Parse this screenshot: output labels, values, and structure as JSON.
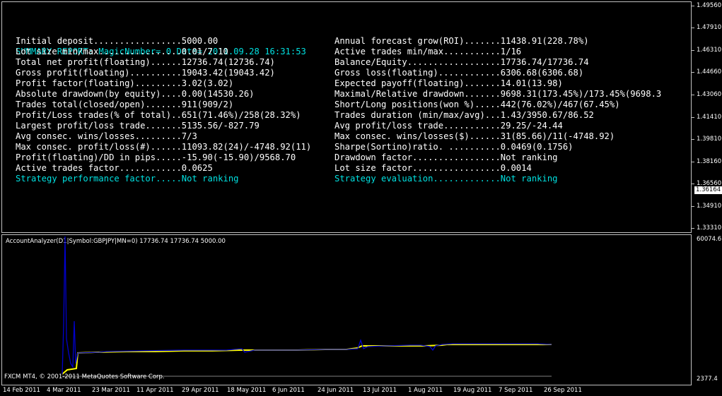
{
  "report": {
    "header": "SUMMARY REPORT: MagicNumber= 0 Date= 2011.09.28 16:31:53",
    "left": [
      "Initial deposit.................5000.00",
      "Lot size min/max................0.01/7.10",
      "Total net profit(floating)......12736.74(12736.74)",
      "Gross profit(floating)..........19043.42(19043.42)",
      "Profit factor(floating).........3.02(3.02)",
      "Absolute drawdown(by equity)....0.00(14530.26)",
      "Trades total(closed/open).......911(909/2)",
      "Profit/Loss trades(% of total)..651(71.46%)/258(28.32%)",
      "Largest profit/loss trade.......5135.56/-827.79",
      "Avg consec. wins/losses.........7/3",
      "Max consec. profit/loss(#)......11093.82(24)/-4748.92(11)",
      "Profit(floating)/DD in pips.....-15.90(-15.90)/9568.70",
      "Active trades factor............0.0625"
    ],
    "left_last": "Strategy performance factor.....Not ranking",
    "right": [
      "Annual forecast grow(ROI).......11438.91(228.78%)",
      "Active trades min/max...........1/16",
      "Balance/Equity..................17736.74/17736.74",
      "Gross loss(floating)............6306.68(6306.68)",
      "Expected payoff(floating).......14.01(13.98)",
      "Maximal/Relative drawdown.......9698.31(173.45%)/173.45%(9698.3",
      "Short/Long positions(won %).....442(76.02%)/467(67.45%)",
      "Trades duration (min/max/avg)...1.43/3950.67/86.52",
      "Avg profit/loss trade...........29.25/-24.44",
      "Max consec. wins/losses($)......31(85.66)/11(-4748.92)",
      "Sharpe(Sortino)ratio. ..........0.0469(0.1756)",
      "Drawdown factor.................Not ranking",
      "Lot size factor.................0.0014"
    ],
    "right_last": "Strategy evaluation.............Not ranking"
  },
  "price_axis": {
    "labels": [
      "1.49560",
      "1.47910",
      "1.46310",
      "1.44660",
      "1.43060",
      "1.41410",
      "1.39810",
      "1.38160",
      "1.36560",
      "1.34910",
      "1.33310"
    ],
    "current": "1.36164"
  },
  "indicator": {
    "title": "AccountAnalyzer(D1|Symbol:GBPJPY|MN=0) 17736.74 17736.74 5000.00",
    "axis_max": "60074.6",
    "axis_min": "2377.4"
  },
  "copyright": "FXCM MT4, © 2001-2011 MetaQuotes Software Corp.",
  "dates": [
    "14 Feb 2011",
    "4 Mar 2011",
    "23 Mar 2011",
    "11 Apr 2011",
    "29 Apr 2011",
    "18 May 2011",
    "6 Jun 2011",
    "24 Jun 2011",
    "13 Jul 2011",
    "1 Aug 2011",
    "19 Aug 2011",
    "7 Sep 2011",
    "26 Sep 2011"
  ],
  "colors": {
    "equity_line": "#0000cc",
    "balance_line": "#ffff00",
    "header_text": "#00e0e0"
  }
}
